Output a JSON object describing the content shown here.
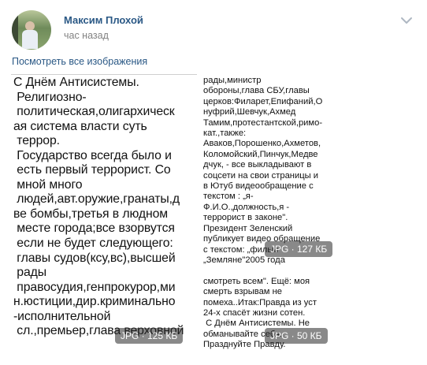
{
  "post": {
    "author_name": "Максим Плохой",
    "time": "час назад",
    "view_all_label": "Посмотреть все изображения"
  },
  "icons": {
    "avatar": "user-avatar",
    "menu": "chevron-down-icon"
  },
  "colors": {
    "link": "#2a5885",
    "meta": "#828282"
  },
  "photos": [
    {
      "text": "С Днём Антисистемы.\n Религиозно-\n политическая,олигархическ\nая система власти суть\n террор.\n Государство всегда было и\n есть первый террорист. Со\n мной много\n людей,авт.оружие,гранаты,д\nве бомбы,третья в людном\n месте города;все взорвутся\n если не будет следующего:\n главы судов(ксу,вс),высшей\n рады\n правосудия,генпрокурор,ми\nн.юстиции,дир.криминально\n-исполнительной\n сл.,премьер,глава верховной",
      "badge": "JPG · 125 КБ"
    },
    {
      "text": "рады,министр\nобороны,глава СБУ,главы\nцерков:Филарет,Епифаний,О\nнуфрий,Шевчук,Ахмед\nТамим,протестантской,римо-\nкат.,также:\nАваков,Порошенко,Ахметов,\nКоломойский,Пинчук,Медве\nдчук, - все выкладывают в\nсоцсети на свои страницы и\nв Ютуб видеообращение с\nтекстом : „я-\nФ.И.О.,должность,я -\nтеррорист в законе\".\nПрезидент Зеленский\nпубликует видео обращение\nс текстом: „фильм\n„Земляне\"2005 года\n\nсмотреть всем\". Ещё: моя\nсмерть взрывам не\nпомеха..Итак:Правда из уст\n24-х спасёт жизни сотен.\n С Днём Антисистемы. Не\nобманывайте себя.\nПразднуйте Правду.",
      "badges": [
        "JPG · 127 КБ",
        "JPG · 50 КБ"
      ]
    }
  ]
}
